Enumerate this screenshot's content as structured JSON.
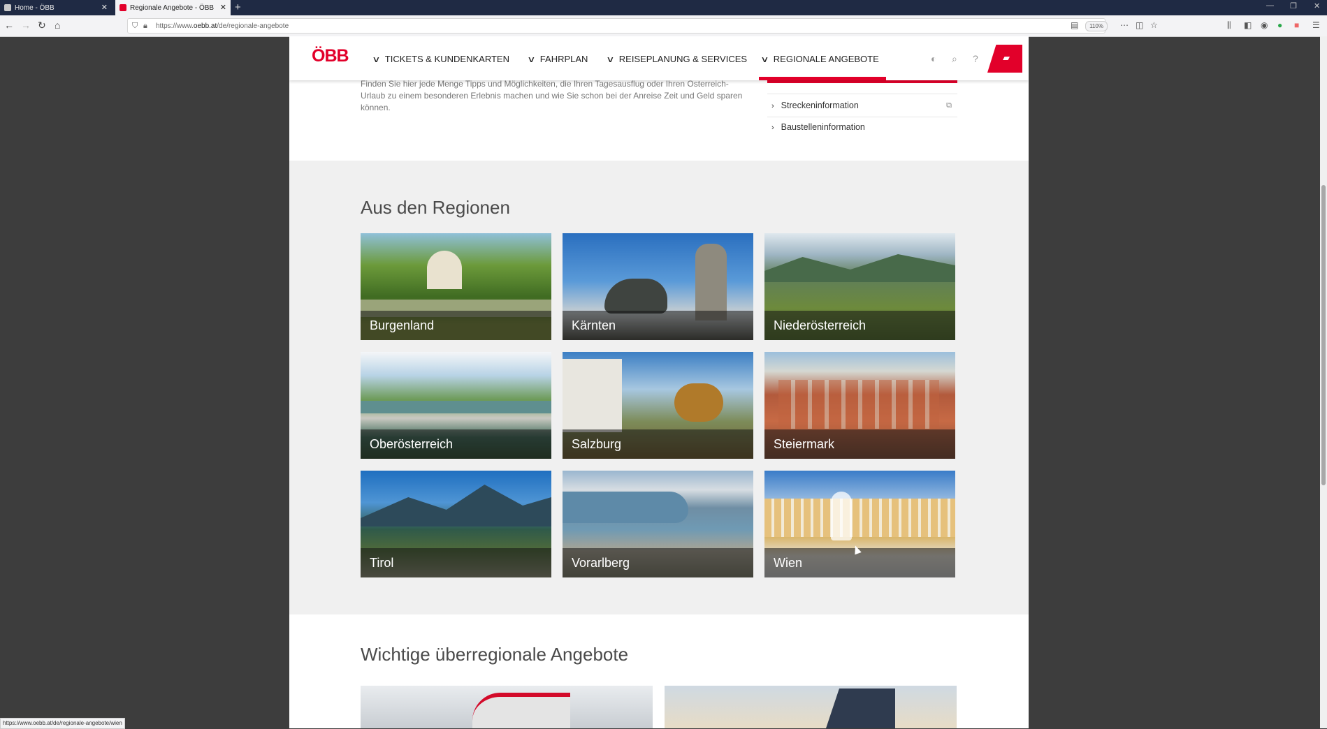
{
  "browser": {
    "tabs": [
      {
        "title": "Home - ÖBB"
      },
      {
        "title": "Regionale Angebote - ÖBB"
      }
    ],
    "url_prefix": "https://www.",
    "url_domain": "oebb.at",
    "url_path": "/de/regionale-angebote",
    "zoom": "110%",
    "status_url": "https://www.oebb.at/de/regionale-angebote/wien"
  },
  "header": {
    "logo": "ÖBB",
    "nav": [
      {
        "label": "TICKETS & KUNDENKARTEN"
      },
      {
        "label": "FAHRPLAN"
      },
      {
        "label": "REISEPLANUNG & SERVICES"
      },
      {
        "label": "REGIONALE ANGEBOTE"
      }
    ]
  },
  "intro": {
    "text": "Finden Sie hier jede Menge Tipps und Möglichkeiten, die Ihren Tagesausflug oder Ihren Österreich-Urlaub zu einem besonderen Erlebnis machen und wie Sie schon bei der Anreise Zeit und Geld sparen können."
  },
  "sidebar_links": [
    {
      "label": "Streckeninformation"
    },
    {
      "label": "Baustelleninformation"
    }
  ],
  "regions": {
    "title": "Aus den Regionen",
    "items": [
      {
        "name": "Burgenland"
      },
      {
        "name": "Kärnten"
      },
      {
        "name": "Niederösterreich"
      },
      {
        "name": "Oberösterreich"
      },
      {
        "name": "Salzburg"
      },
      {
        "name": "Steiermark"
      },
      {
        "name": "Tirol"
      },
      {
        "name": "Vorarlberg"
      },
      {
        "name": "Wien"
      }
    ]
  },
  "offers": {
    "title": "Wichtige überregionale Angebote"
  },
  "colors": {
    "brand_red": "#e2002a",
    "region_bg": "#f0f0f0"
  }
}
